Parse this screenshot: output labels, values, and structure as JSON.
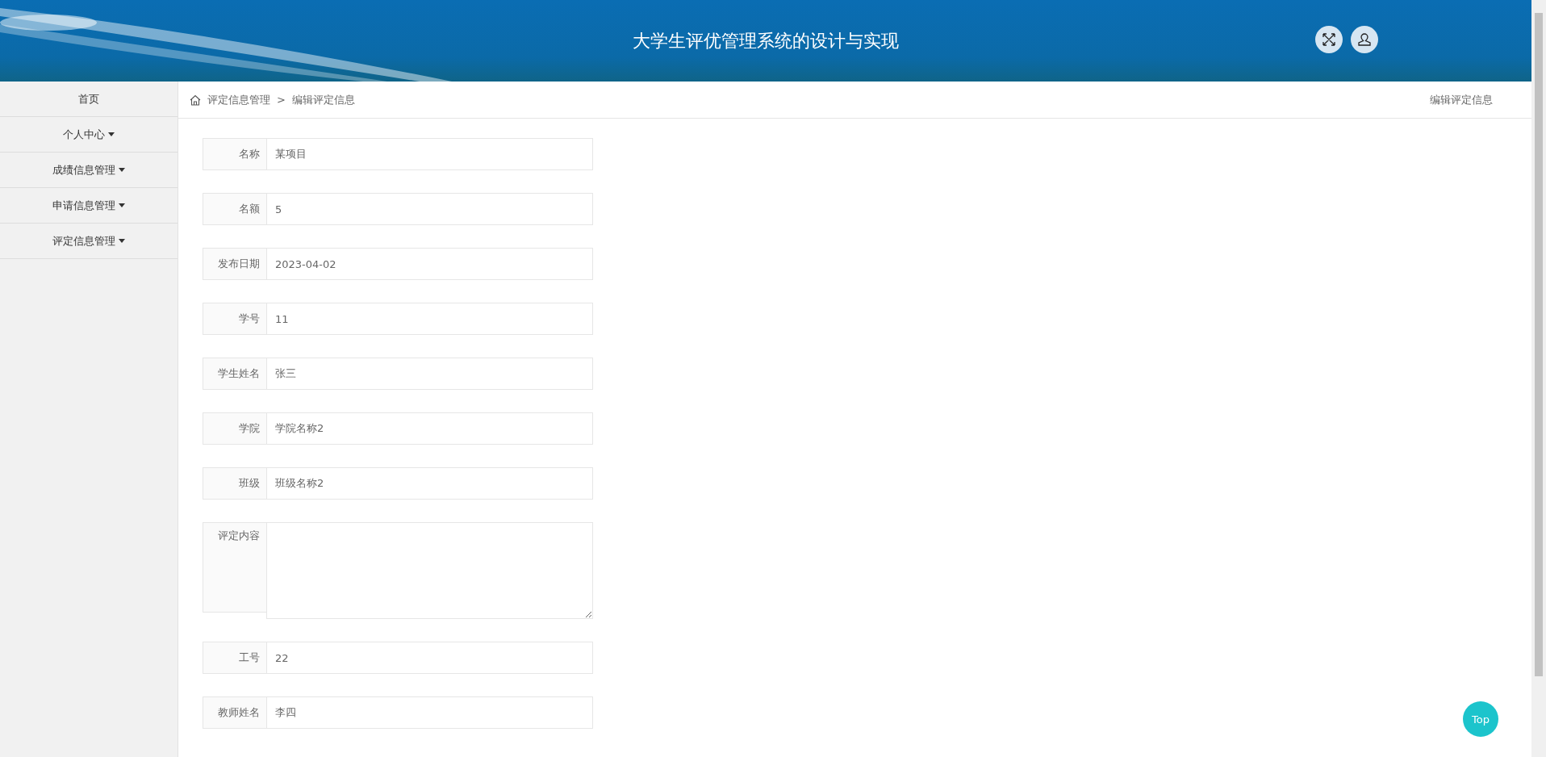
{
  "header": {
    "title": "大学生评优管理系统的设计与实现"
  },
  "sidebar": {
    "items": [
      {
        "label": "首页",
        "has_submenu": false
      },
      {
        "label": "个人中心",
        "has_submenu": true
      },
      {
        "label": "成绩信息管理",
        "has_submenu": true
      },
      {
        "label": "申请信息管理",
        "has_submenu": true
      },
      {
        "label": "评定信息管理",
        "has_submenu": true
      }
    ]
  },
  "breadcrumb": {
    "items": [
      "评定信息管理",
      "编辑评定信息"
    ],
    "separator": ">",
    "page_title": "编辑评定信息"
  },
  "form": {
    "fields": [
      {
        "kind": "input",
        "label": "名称",
        "value": "某项目"
      },
      {
        "kind": "input",
        "label": "名额",
        "value": "5"
      },
      {
        "kind": "input",
        "label": "发布日期",
        "value": "2023-04-02"
      },
      {
        "kind": "input",
        "label": "学号",
        "value": "11"
      },
      {
        "kind": "input",
        "label": "学生姓名",
        "value": "张三"
      },
      {
        "kind": "input",
        "label": "学院",
        "value": "学院名称2"
      },
      {
        "kind": "input",
        "label": "班级",
        "value": "班级名称2"
      },
      {
        "kind": "textarea",
        "label": "评定内容"
      },
      {
        "kind": "input",
        "label": "工号",
        "value": "22"
      },
      {
        "kind": "input",
        "label": "教师姓名",
        "value": "李四"
      }
    ]
  },
  "top_button": {
    "label": "Top"
  }
}
